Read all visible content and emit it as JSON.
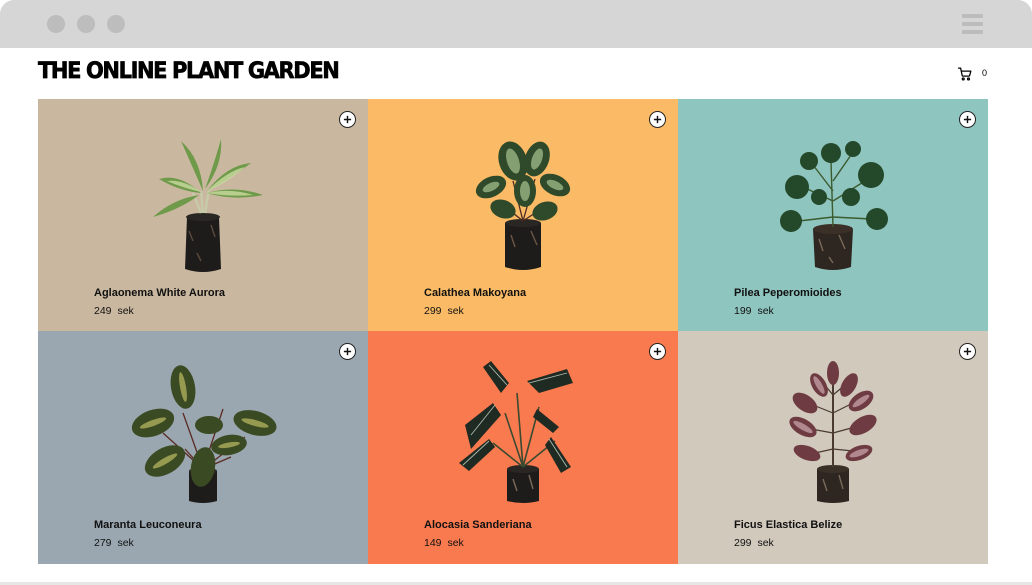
{
  "browser": {
    "dots": [
      "close",
      "minimize",
      "maximize"
    ],
    "menu_icon": "hamburger-menu-icon"
  },
  "header": {
    "title": "THE ONLINE PLANT GARDEN",
    "cart_icon": "cart-icon",
    "cart_count": "0"
  },
  "colors": {
    "chrome": "#d6d6d6",
    "card_1": "#c9b89f",
    "card_2": "#fbbb66",
    "card_3": "#8fc5bf",
    "card_4": "#9aa7b0",
    "card_5": "#fa7a4f",
    "card_6": "#d2c9bd"
  },
  "products": [
    {
      "name": "Aglaonema White Aurora",
      "price": "249",
      "currency": "sek",
      "add_icon": "plus-icon"
    },
    {
      "name": "Calathea Makoyana",
      "price": "299",
      "currency": "sek",
      "add_icon": "plus-icon"
    },
    {
      "name": "Pilea Peperomioides",
      "price": "199",
      "currency": "sek",
      "add_icon": "plus-icon"
    },
    {
      "name": "Maranta Leuconeura",
      "price": "279",
      "currency": "sek",
      "add_icon": "plus-icon"
    },
    {
      "name": "Alocasia Sanderiana",
      "price": "149",
      "currency": "sek",
      "add_icon": "plus-icon"
    },
    {
      "name": "Ficus Elastica Belize",
      "price": "299",
      "currency": "sek",
      "add_icon": "plus-icon"
    }
  ]
}
